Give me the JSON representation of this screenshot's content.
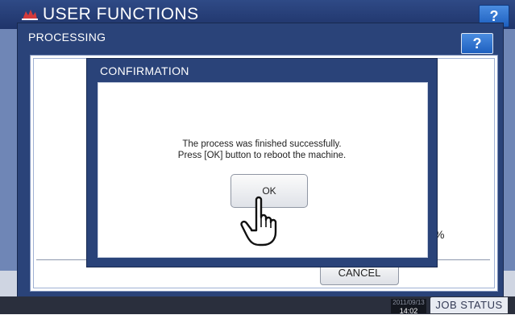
{
  "background": {
    "app_title": "USER FUNCTIONS",
    "help_label": "?",
    "percent_symbol": "%",
    "status": {
      "date": "2011/09/13",
      "time": "14:02",
      "job_status_label": "JOB STATUS"
    }
  },
  "processing": {
    "title": "PROCESSING",
    "help_label": "?",
    "cancel_label": "CANCEL"
  },
  "confirmation": {
    "title": "CONFIRMATION",
    "message_line1": "The process was finished successfully.",
    "message_line2": "Press [OK] button to reboot the machine.",
    "ok_label": "OK"
  },
  "icons": {
    "logo": "toshiba-logo-icon",
    "pointer": "hand-pointer-icon"
  },
  "colors": {
    "titlebar_blue": "#2a4379",
    "help_blue": "#1d5fbf",
    "status_bar": "#2a2f3d"
  }
}
